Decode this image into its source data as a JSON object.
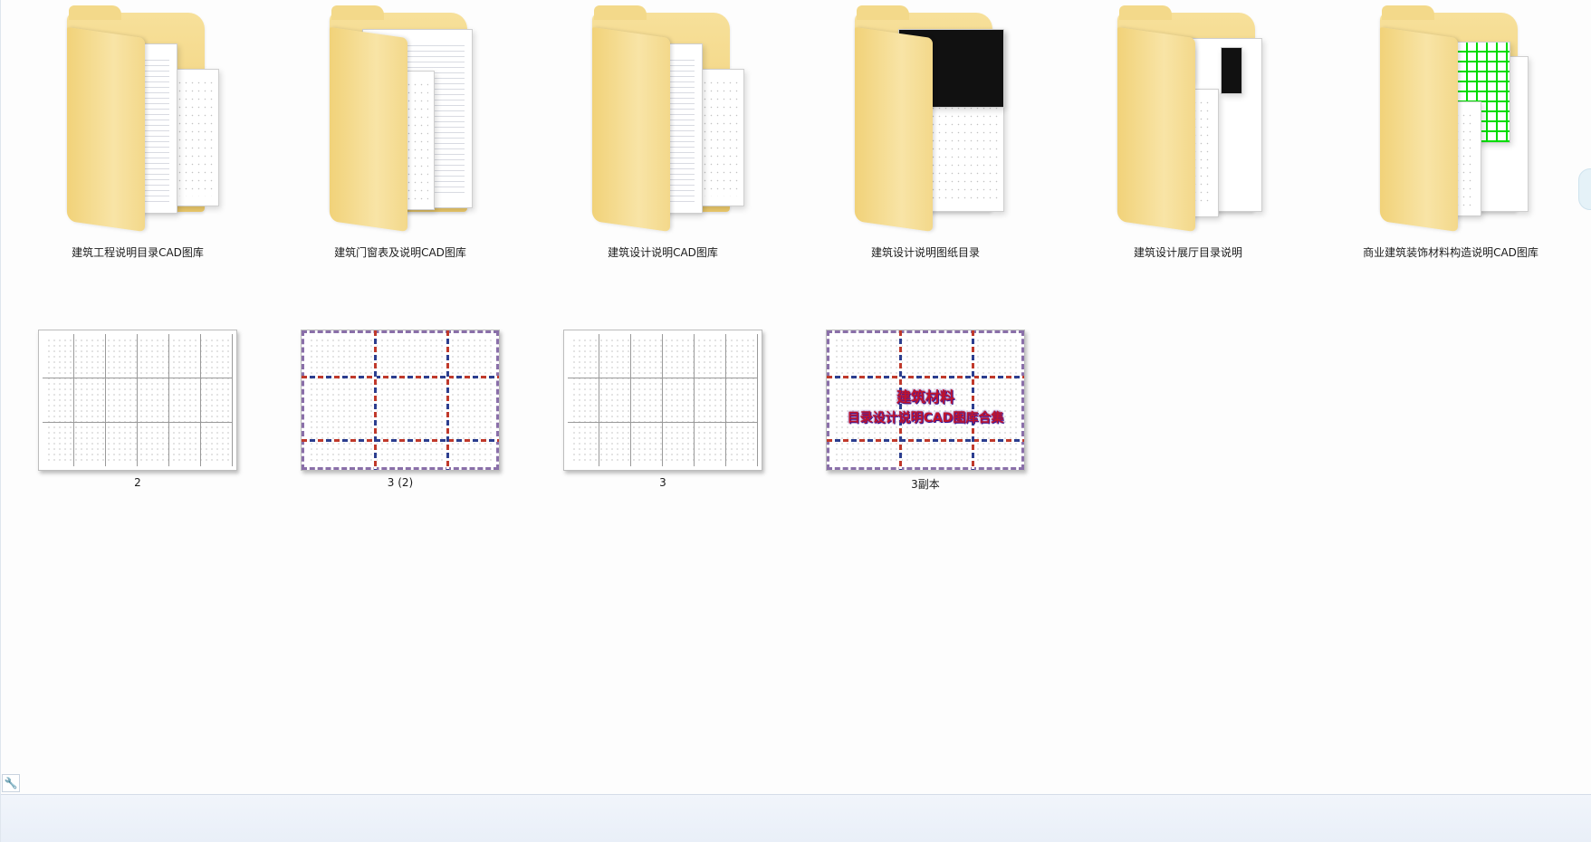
{
  "folders": [
    {
      "name": "建筑工程说明目录CAD图库",
      "preview": "lines"
    },
    {
      "name": "建筑门窗表及说明CAD图库",
      "preview": "lines"
    },
    {
      "name": "建筑设计说明CAD图库",
      "preview": "lines"
    },
    {
      "name": "建筑设计说明图纸目录",
      "preview": "black"
    },
    {
      "name": "建筑设计展厅目录说明",
      "preview": "black"
    },
    {
      "name": "商业建筑装饰材料构造说明CAD图库",
      "preview": "green"
    }
  ],
  "images": [
    {
      "name": "2",
      "preview": "table"
    },
    {
      "name": "3 (2)",
      "preview": "airmail"
    },
    {
      "name": "3",
      "preview": "table"
    },
    {
      "name": "3副本",
      "preview": "airmail-title"
    }
  ],
  "overlay": {
    "line1": "建筑材料",
    "line2": "目录设计说明CAD图库合集"
  },
  "icons": {
    "status_tool": "wrench-icon",
    "folder": "folder-icon",
    "image": "image-file-icon"
  },
  "colors": {
    "folder": "#eecb6c",
    "overlay_text": "#c0132b",
    "statusbar": "#e9eff8"
  }
}
